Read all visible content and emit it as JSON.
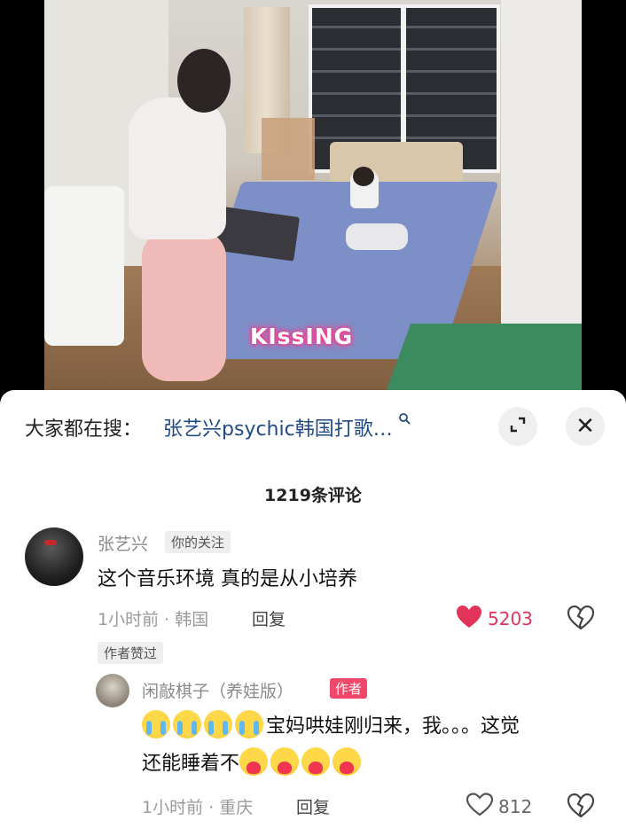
{
  "video": {
    "caption": "KIssING"
  },
  "sheet": {
    "search_prefix": "大家都在搜：",
    "search_term": "张艺兴psychic韩国打歌…",
    "search_icon": "search-icon",
    "expand_icon": "expand-icon",
    "close_icon": "close-icon",
    "close_glyph": "✕",
    "comment_count": "1219条评论"
  },
  "comments": [
    {
      "username": "张艺兴",
      "follow_tag": "你的关注",
      "text": "这个音乐环境 真的是从小培养",
      "meta": "1小时前 · 韩国",
      "reply_label": "回复",
      "likes": "5203",
      "liked": true,
      "author_liked": "作者赞过"
    }
  ],
  "replies": [
    {
      "username": "闲敲棋子（养娃版）",
      "author_tag": "作者",
      "text_line1": "宝妈哄娃刚归来，我。。。这觉",
      "text_line2": "还能睡着不",
      "meta": "1小时前 · 重庆",
      "reply_label": "回复",
      "likes": "812",
      "liked": false
    }
  ],
  "colors": {
    "link_blue": "#1f4b86",
    "like_red": "#e2345a",
    "author_tag_pink": "#f0486a"
  }
}
